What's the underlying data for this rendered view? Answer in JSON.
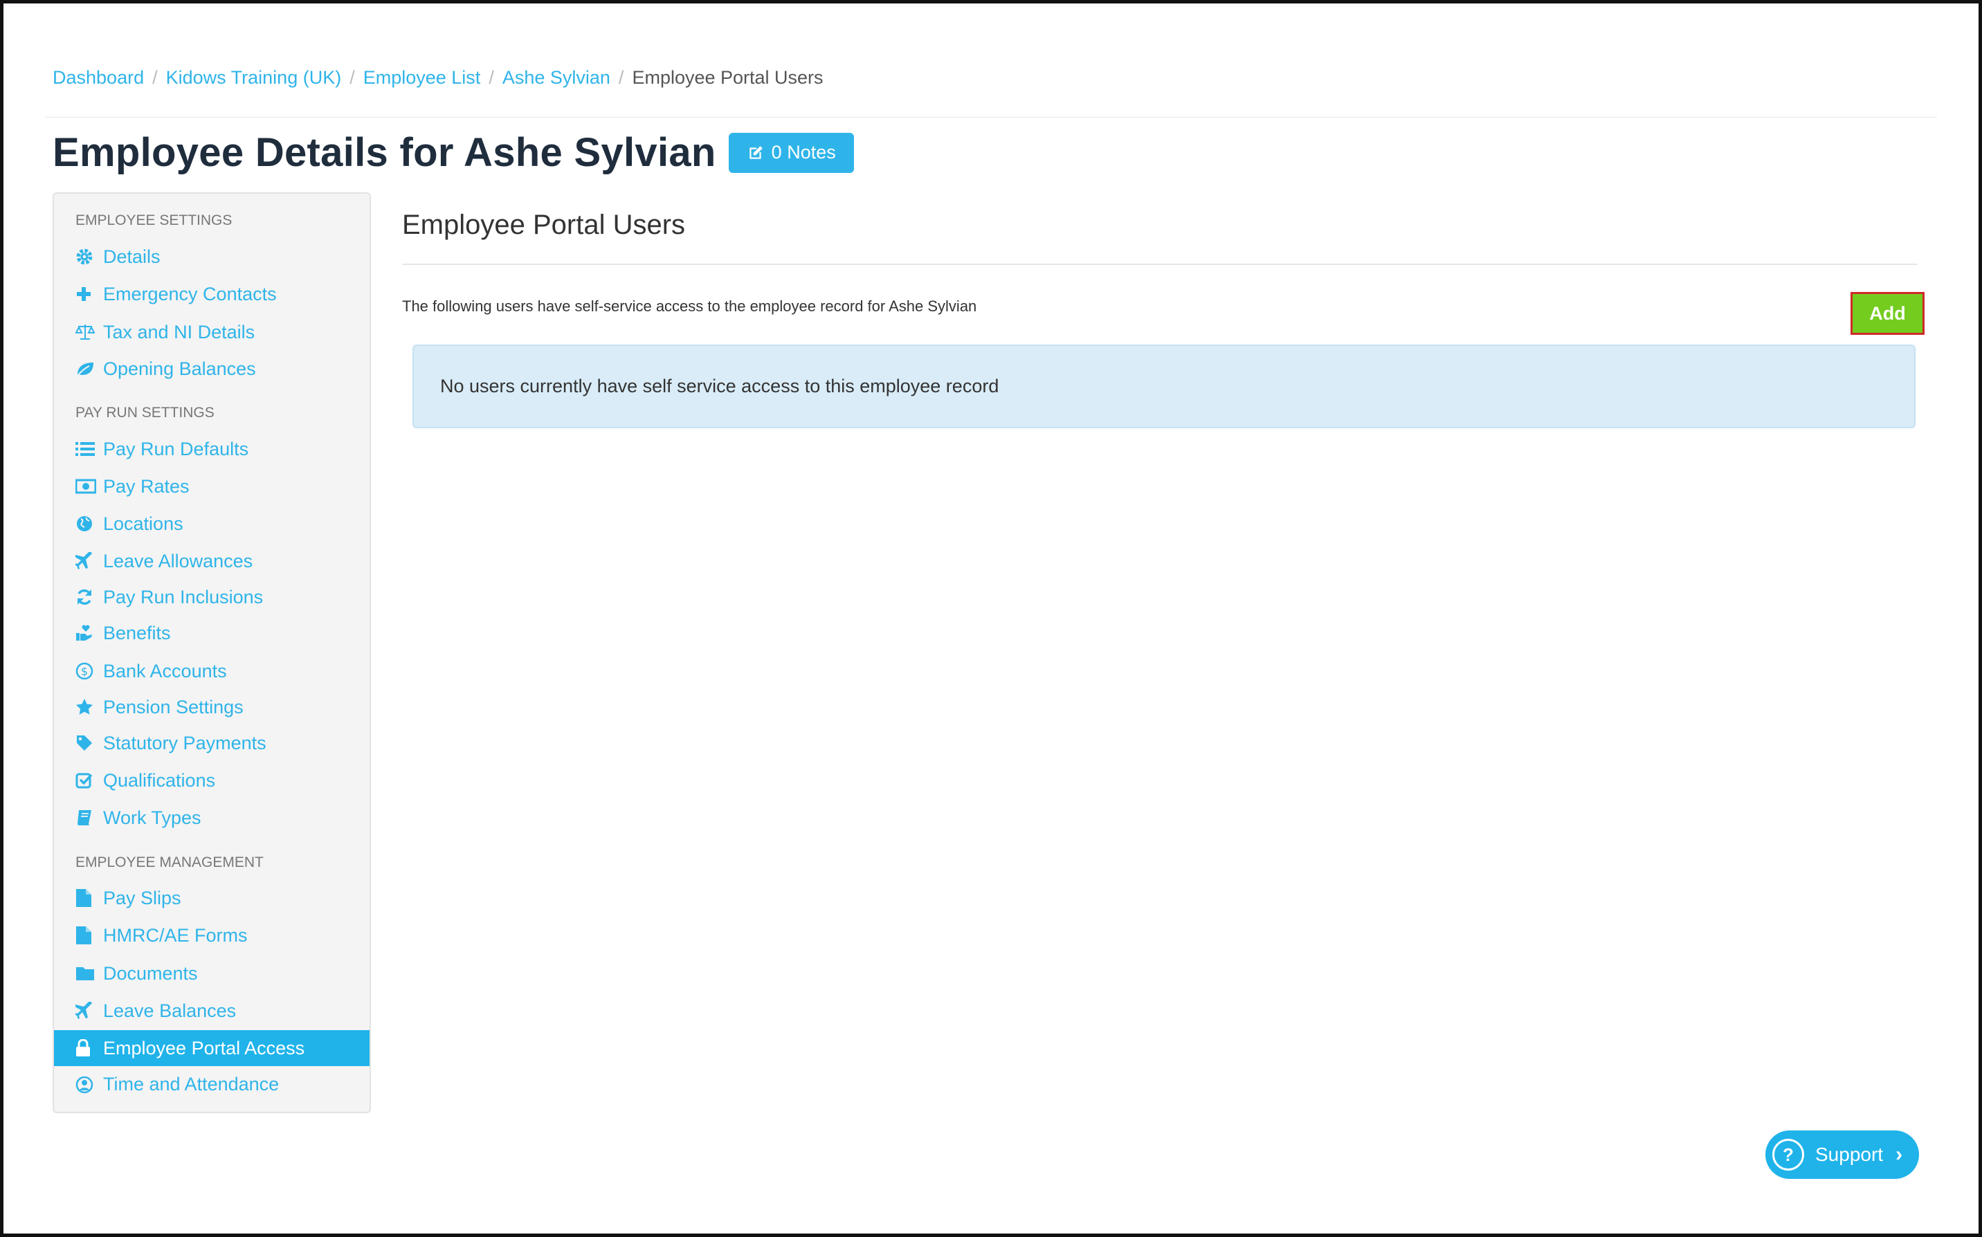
{
  "breadcrumb": {
    "items": [
      "Dashboard",
      "Kidows Training (UK)",
      "Employee List",
      "Ashe Sylvian"
    ],
    "current": "Employee Portal Users",
    "separator": "/"
  },
  "header": {
    "title": "Employee Details for Ashe Sylvian",
    "notes_label": "0 Notes"
  },
  "sidebar": {
    "section_employee_settings": "EMPLOYEE SETTINGS",
    "section_pay_run_settings": "PAY RUN SETTINGS",
    "section_employee_management": "EMPLOYEE MANAGEMENT",
    "items": [
      "Details",
      "Emergency Contacts",
      "Tax and NI Details",
      "Opening Balances",
      "Pay Run Defaults",
      "Pay Rates",
      "Locations",
      "Leave Allowances",
      "Pay Run Inclusions",
      "Benefits",
      "Bank Accounts",
      "Pension Settings",
      "Statutory Payments",
      "Qualifications",
      "Work Types",
      "Pay Slips",
      "HMRC/AE Forms",
      "Documents",
      "Leave Balances",
      "Employee Portal Access",
      "Time and Attendance"
    ],
    "active_item": "Employee Portal Access"
  },
  "main": {
    "title": "Employee Portal Users",
    "description": "The following users have self-service access to the employee record for Ashe Sylvian",
    "add_label": "Add",
    "empty_message": "No users currently have self service access to this employee record"
  },
  "support": {
    "label": "Support"
  },
  "colors": {
    "accent": "#2fb4e9",
    "add_button": "#74cc1f",
    "alert_bg": "#d9ecf7",
    "highlight_border": "#d02a2a"
  }
}
